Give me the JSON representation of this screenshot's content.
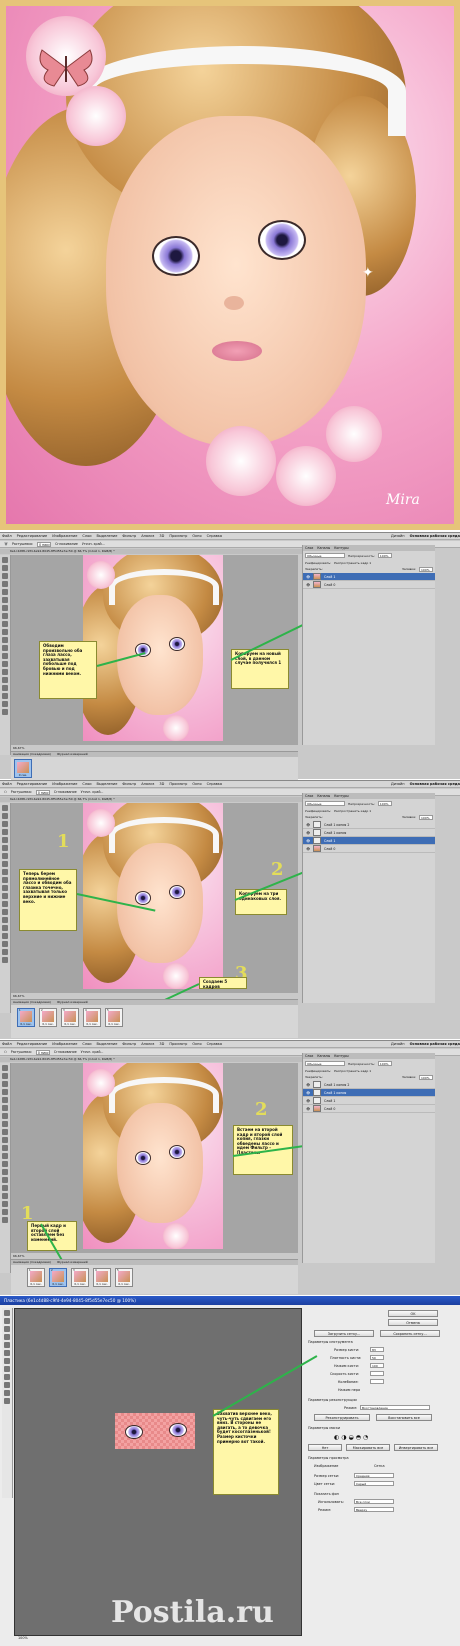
{
  "hero": {
    "signature": "Mira"
  },
  "menu": {
    "items": [
      "Файл",
      "Редактирование",
      "Изображение",
      "Слои",
      "Выделение",
      "Фильтр",
      "Анализ",
      "3D",
      "Просмотр",
      "Окно",
      "Справка"
    ],
    "workspace": "Основная рабочая среда",
    "design": "Дизайн"
  },
  "options": {
    "feather_label": "Растушевка:",
    "feather_value": "0 пикс",
    "smoothing": "Сглаживание",
    "style_label": "Стиль:",
    "style_value": "Обычный",
    "refine_edge": "Уточн. край..."
  },
  "document_tab": "6e1c4d88-c9fd-4e94-8045-8f5d55e7ec50 @ 66,7% (Слой 1, RGB/8) *",
  "status": {
    "zoom": "66,67%"
  },
  "animation_tab": "Анимация (покадровая)",
  "measure_tab": "Журнал измерений",
  "layers_panel": {
    "tabs": [
      "Слои",
      "Каналы",
      "Контуры"
    ],
    "blend_mode": "Обычные",
    "opacity_label": "Непрозрачность:",
    "opacity_value": "100%",
    "unify_label": "Унифицировать:",
    "spread_label": "Распространить кадр 1",
    "lock_label": "Закрепить:",
    "fill_label": "Заливка:",
    "fill_value": "100%"
  },
  "screen1": {
    "layers": [
      "Слой 1",
      "Слой 0"
    ],
    "note_left": "Обводим произвольно оба глаза лассо, захватывая побольше под бровью и под нижними веком.",
    "note_right": "Копируем на новый слой, в данном случае получился 1",
    "frame_label": "0 сек."
  },
  "screen2": {
    "layers": [
      "Слой 1 копия 2",
      "Слой 1 копия",
      "Слой 1",
      "Слой 0"
    ],
    "note_left": "Теперь берем прямолинейное лассо и обводим оба глазика точечно, захватывая только верхние и нижние веко.",
    "note_right": "Копируем на три одинаковых слоя.",
    "note_frames": "Создаем 5 кадров",
    "num1": "1",
    "num2": "2",
    "num3": "3",
    "frames": [
      "0,1 сек.",
      "0,1 сек.",
      "0,1 сек.",
      "0,1 сек.",
      "0,1 сек."
    ],
    "frame_numbers": [
      "1",
      "2",
      "3",
      "4",
      "5"
    ]
  },
  "screen3": {
    "layers": [
      "Слой 1 копия 2",
      "Слой 1 копия",
      "Слой 1",
      "Слой 0"
    ],
    "note_left": "Первый кадр и второй слой оставляем без изменений.",
    "note_right": "Встаем на второй кадр и второй слой копия, глазки обведены лассо и идем Фильтр - Пластика.",
    "num1": "1",
    "num2": "2",
    "frames": [
      "0,1 сек.",
      "0,1 сек.",
      "0,1 сек.",
      "0,1 сек.",
      "0,1 сек."
    ],
    "frame_numbers": [
      "1",
      "2",
      "3",
      "4",
      "5"
    ]
  },
  "liquify": {
    "title": "Пластика (6e1c4d88-c9fd-4e94-8045-8f5d55e7ec50 @ 100%)",
    "ok": "OK",
    "cancel": "Отмена",
    "load_mesh": "Загрузить сетку...",
    "save_mesh": "Сохранить сетку...",
    "tool_options": "Параметры инструмента",
    "brush_size_label": "Размер кисти:",
    "brush_size": "83",
    "brush_density_label": "Плотность кисти:",
    "brush_density": "50",
    "brush_pressure_label": "Нажим кисти:",
    "brush_pressure": "100",
    "brush_rate_label": "Скорость кисти:",
    "turbulent_label": "Колебание:",
    "pen_pressure": "Нажим пера",
    "reconstruct_options": "Параметры реконструкции",
    "mode_label": "Режим:",
    "mode_value": "Восстановление",
    "reconstruct_btn": "Реконструировать",
    "restore_all": "Восстановить все",
    "mask_options": "Параметры маски",
    "none_btn": "Нет",
    "mask_all": "Маскировать все",
    "invert_all": "Инвертировать все",
    "view_options": "Параметры просмотра",
    "show_image": "Изображение",
    "show_mesh": "Сетка",
    "mesh_size_label": "Размер сетки:",
    "mesh_size_value": "Средняя",
    "mesh_color_label": "Цвет сетки:",
    "mesh_color_value": "Серый",
    "show_backdrop": "Показать фон",
    "use_label": "Использовать:",
    "use_value": "Все слои",
    "backdrop_mode_label": "Режим:",
    "backdrop_mode_value": "Вверху",
    "zoom": "100%",
    "note": "Захватив верхнее веко, чуть-чуть сдвигаем его вниз. В стороны не двигать, а то девочка будет косоглазенькой! Размер кисточки примерно вот такой."
  },
  "watermark": "Postila.ru",
  "colors": {
    "accent": "#3e6db5",
    "note_bg": "#fff7a8",
    "arrow": "#2eb34a",
    "hero_frame": "#e6c47a"
  }
}
